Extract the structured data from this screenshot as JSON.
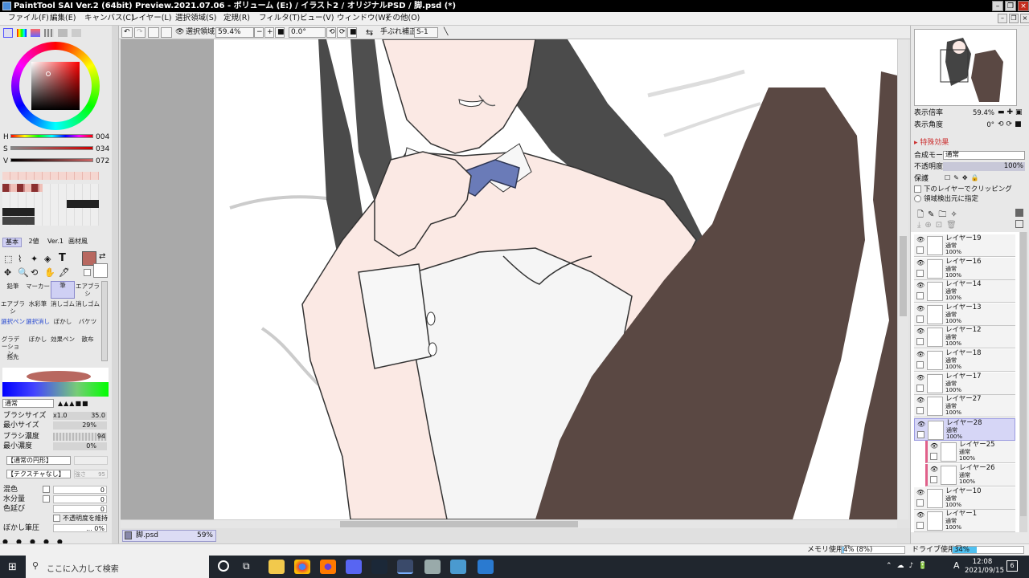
{
  "window": {
    "title": "PaintTool SAI Ver.2 (64bit) Preview.2021.07.06 - ボリューム (E:) / イラスト2 / オリジナルPSD / 脚.psd (*)"
  },
  "menu": [
    "ファイル(F)",
    "編集(E)",
    "キャンバス(C)",
    "レイヤー(L)",
    "選択領域(S)",
    "定規(R)",
    "フィルタ(T)",
    "ビュー(V)",
    "ウィンドウ(W)",
    "その他(O)"
  ],
  "toolbar": {
    "selection_label": "選択領域",
    "zoom": "59.4%",
    "angle": "0.0°",
    "stabilizer_label": "手ぶれ補正",
    "stabilizer_value": "S-1"
  },
  "color": {
    "h_label": "H",
    "h_value": "004",
    "s_label": "S",
    "s_value": "034",
    "v_label": "V",
    "v_value": "072",
    "current": "#b86860"
  },
  "tool_tabs": [
    "基本",
    "2値",
    "Ver.1",
    "画材風"
  ],
  "tools": [
    "鉛筆",
    "マーカー",
    "筆",
    "エアブラシ",
    "エアブラシ",
    "水彩筆",
    "消しゴム",
    "消しゴム",
    "選択ペン",
    "選択消し",
    "ぼかし",
    "バケツ",
    "グラデーション",
    "ぼかし",
    "効果ペン",
    "散布",
    "指先"
  ],
  "brush": {
    "mode": "通常",
    "size_label": "ブラシサイズ",
    "size_mult": "x1.0",
    "size_value": "35.0",
    "min_size_label": "最小サイズ",
    "min_size_value": "29%",
    "density_label": "ブラシ濃度",
    "density_value": "94",
    "min_density_label": "最小濃度",
    "min_density_value": "0%",
    "shape": "【通常の円形】",
    "texture": "【テクスチャなし】",
    "texture_val": "強さ",
    "texture_num": "95",
    "blend_label": "混色",
    "blend_value": "0",
    "water_label": "水分量",
    "water_value": "0",
    "stretch_label": "色延び",
    "stretch_value": "0",
    "keep_opacity": "不透明度を維持",
    "blur_label": "ぼかし筆圧",
    "blur_value": "... 0%"
  },
  "navigator": {
    "zoom_label": "表示倍率",
    "zoom_value": "59.4%",
    "angle_label": "表示角度",
    "angle_value": "0°"
  },
  "layer_props": {
    "effects": "特殊効果",
    "blend_label": "合成モード",
    "blend_value": "通常",
    "opacity_label": "不透明度",
    "opacity_value": "100%",
    "protect_label": "保護",
    "clip": "下のレイヤーでクリッピング",
    "source": "領域検出元に指定"
  },
  "layers": [
    {
      "name": "レイヤー19",
      "mode": "通常",
      "opacity": "100%",
      "selected": false,
      "clipped": false
    },
    {
      "name": "レイヤー16",
      "mode": "通常",
      "opacity": "100%",
      "selected": false,
      "clipped": false
    },
    {
      "name": "レイヤー14",
      "mode": "通常",
      "opacity": "100%",
      "selected": false,
      "clipped": false
    },
    {
      "name": "レイヤー13",
      "mode": "通常",
      "opacity": "100%",
      "selected": false,
      "clipped": false
    },
    {
      "name": "レイヤー12",
      "mode": "通常",
      "opacity": "100%",
      "selected": false,
      "clipped": false
    },
    {
      "name": "レイヤー18",
      "mode": "通常",
      "opacity": "100%",
      "selected": false,
      "clipped": false
    },
    {
      "name": "レイヤー17",
      "mode": "通常",
      "opacity": "100%",
      "selected": false,
      "clipped": false
    },
    {
      "name": "レイヤー27",
      "mode": "通常",
      "opacity": "100%",
      "selected": false,
      "clipped": false
    },
    {
      "name": "レイヤー28",
      "mode": "通常",
      "opacity": "100%",
      "selected": true,
      "clipped": false
    },
    {
      "name": "レイヤー25",
      "mode": "通常",
      "opacity": "100%",
      "selected": false,
      "clipped": true
    },
    {
      "name": "レイヤー26",
      "mode": "通常",
      "opacity": "100%",
      "selected": false,
      "clipped": true
    },
    {
      "name": "レイヤー10",
      "mode": "通常",
      "opacity": "100%",
      "selected": false,
      "clipped": false
    },
    {
      "name": "レイヤー1",
      "mode": "通常",
      "opacity": "100%",
      "selected": false,
      "clipped": false
    }
  ],
  "doc_tab": {
    "name": "脚.psd",
    "zoom": "59%"
  },
  "status": {
    "mem_label": "メモリ使用量",
    "mem_value": "4% (8%)",
    "drive_label": "ドライブ使用量",
    "drive_value": "34%"
  },
  "taskbar": {
    "search_placeholder": "ここに入力して検索",
    "time": "12:08",
    "date": "2021/09/15",
    "ime": "A",
    "notify": "6"
  }
}
